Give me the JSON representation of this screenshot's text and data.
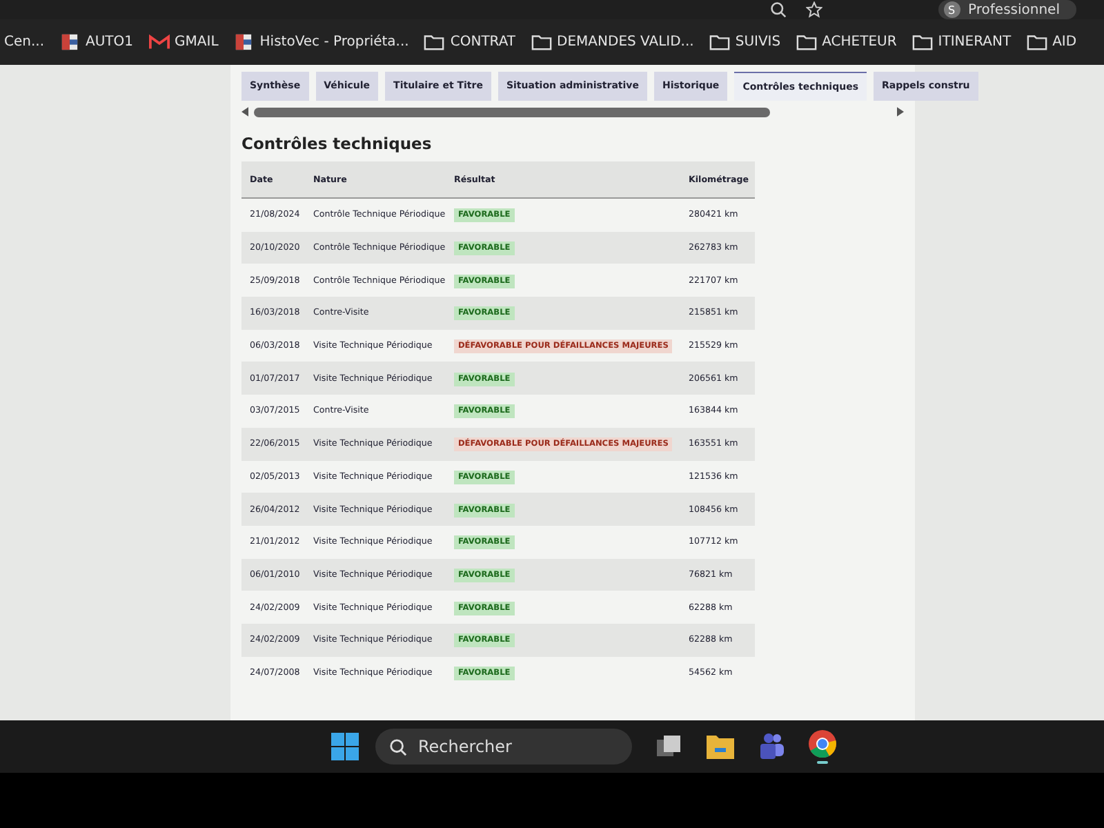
{
  "browser": {
    "profile_initial": "S",
    "profile_name": "Professionnel"
  },
  "bookmarks": [
    {
      "kind": "plain",
      "label": "Cen..."
    },
    {
      "kind": "site",
      "label": "AUTO1"
    },
    {
      "kind": "mail",
      "label": "GMAIL"
    },
    {
      "kind": "site",
      "label": "HistoVec - Propriéta..."
    },
    {
      "kind": "folder",
      "label": "CONTRAT"
    },
    {
      "kind": "folder",
      "label": "DEMANDES VALID..."
    },
    {
      "kind": "folder",
      "label": "SUIVIS"
    },
    {
      "kind": "folder",
      "label": "ACHETEUR"
    },
    {
      "kind": "folder",
      "label": "ITINERANT"
    },
    {
      "kind": "folder",
      "label": "AID"
    }
  ],
  "tabs": [
    {
      "label": "Synthèse",
      "selected": false
    },
    {
      "label": "Véhicule",
      "selected": false
    },
    {
      "label": "Titulaire et Titre",
      "selected": false
    },
    {
      "label": "Situation administrative",
      "selected": false
    },
    {
      "label": "Historique",
      "selected": false
    },
    {
      "label": "Contrôles techniques",
      "selected": true
    },
    {
      "label": "Rappels constru",
      "selected": false
    }
  ],
  "section": {
    "title": "Contrôles techniques",
    "columns": [
      "Date",
      "Nature",
      "Résultat",
      "Kilométrage"
    ],
    "rows": [
      {
        "date": "21/08/2024",
        "nature": "Contrôle Technique Périodique",
        "kind": "favorable",
        "result": "FAVORABLE",
        "km": "280421 km"
      },
      {
        "date": "20/10/2020",
        "nature": "Contrôle Technique Périodique",
        "kind": "favorable",
        "result": "FAVORABLE",
        "km": "262783 km"
      },
      {
        "date": "25/09/2018",
        "nature": "Contrôle Technique Périodique",
        "kind": "favorable",
        "result": "FAVORABLE",
        "km": "221707 km"
      },
      {
        "date": "16/03/2018",
        "nature": "Contre-Visite",
        "kind": "favorable",
        "result": "FAVORABLE",
        "km": "215851 km"
      },
      {
        "date": "06/03/2018",
        "nature": "Visite Technique Périodique",
        "kind": "unfavorable",
        "result": "DÉFAVORABLE POUR DÉFAILLANCES MAJEURES",
        "km": "215529 km"
      },
      {
        "date": "01/07/2017",
        "nature": "Visite Technique Périodique",
        "kind": "favorable",
        "result": "FAVORABLE",
        "km": "206561 km"
      },
      {
        "date": "03/07/2015",
        "nature": "Contre-Visite",
        "kind": "favorable",
        "result": "FAVORABLE",
        "km": "163844 km"
      },
      {
        "date": "22/06/2015",
        "nature": "Visite Technique Périodique",
        "kind": "unfavorable",
        "result": "DÉFAVORABLE POUR DÉFAILLANCES MAJEURES",
        "km": "163551 km"
      },
      {
        "date": "02/05/2013",
        "nature": "Visite Technique Périodique",
        "kind": "favorable",
        "result": "FAVORABLE",
        "km": "121536 km"
      },
      {
        "date": "26/04/2012",
        "nature": "Visite Technique Périodique",
        "kind": "favorable",
        "result": "FAVORABLE",
        "km": "108456 km"
      },
      {
        "date": "21/01/2012",
        "nature": "Visite Technique Périodique",
        "kind": "favorable",
        "result": "FAVORABLE",
        "km": "107712 km"
      },
      {
        "date": "06/01/2010",
        "nature": "Visite Technique Périodique",
        "kind": "favorable",
        "result": "FAVORABLE",
        "km": "76821 km"
      },
      {
        "date": "24/02/2009",
        "nature": "Visite Technique Périodique",
        "kind": "favorable",
        "result": "FAVORABLE",
        "km": "62288 km"
      },
      {
        "date": "24/02/2009",
        "nature": "Visite Technique Périodique",
        "kind": "favorable",
        "result": "FAVORABLE",
        "km": "62288 km"
      },
      {
        "date": "24/07/2008",
        "nature": "Visite Technique Périodique",
        "kind": "favorable",
        "result": "FAVORABLE",
        "km": "54562 km"
      }
    ]
  },
  "taskbar": {
    "search_placeholder": "Rechercher"
  }
}
